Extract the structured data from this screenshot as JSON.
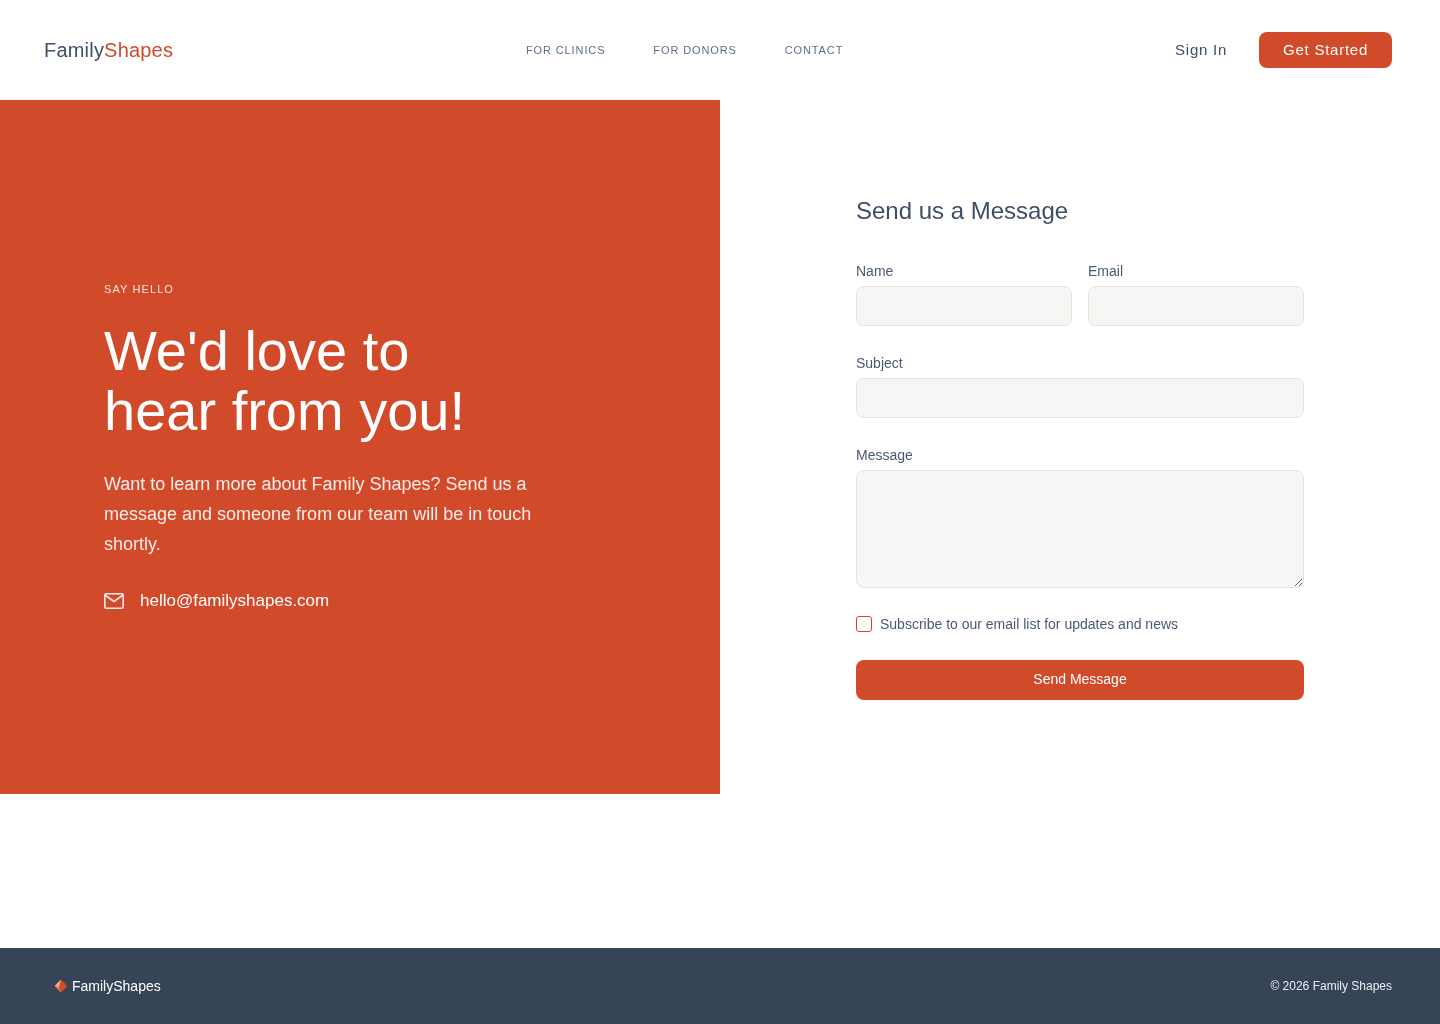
{
  "header": {
    "logo": [
      "Family",
      "Shapes"
    ],
    "nav": [
      {
        "label": "FOR CLINICS"
      },
      {
        "label": "FOR DONORS"
      },
      {
        "label": "CONTACT"
      }
    ],
    "sign_in": "Sign In",
    "cta": "Get Started"
  },
  "hero": {
    "eyebrow": "SAY HELLO",
    "headline": [
      "We'd love to",
      "hear from you!"
    ],
    "body": "Want to learn more about Family Shapes? Send us a message and someone from our team will be in touch shortly.",
    "email": "hello@familyshapes.com"
  },
  "form": {
    "title": "Send us a Message",
    "rows": [
      [
        {
          "label": "Name",
          "kind": "text"
        },
        {
          "label": "Email",
          "kind": "text"
        }
      ],
      [
        {
          "label": "Subject",
          "kind": "text"
        }
      ],
      [
        {
          "label": "Message",
          "kind": "textarea"
        }
      ]
    ],
    "subscribe": {
      "label": "Subscribe to our email list for updates and news",
      "checked": false
    },
    "submit": "Send Message"
  },
  "footer": {
    "logo": "FamilyShapes",
    "copyright": "© 2026 Family Shapes"
  }
}
